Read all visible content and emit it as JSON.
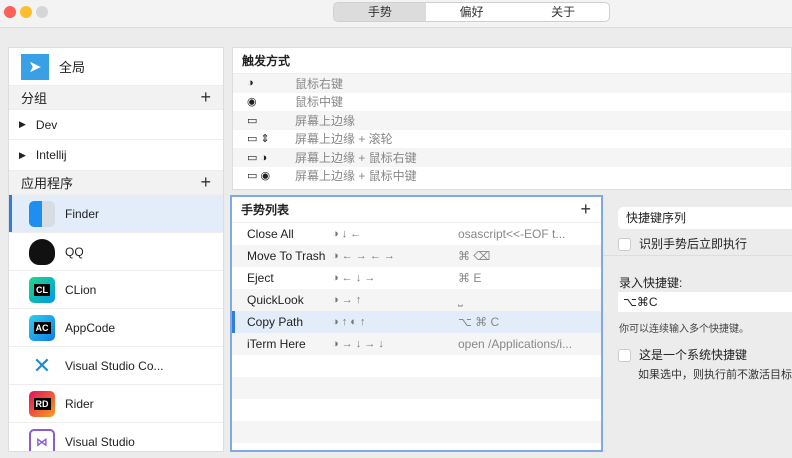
{
  "window": {
    "tabs": [
      {
        "label": "手势",
        "selected": true
      },
      {
        "label": "偏好"
      },
      {
        "label": "关于"
      }
    ]
  },
  "sidebar": {
    "global": "全局",
    "groups_header": "分组",
    "groups": [
      "Dev",
      "Intellij"
    ],
    "apps_header": "应用程序",
    "apps": [
      {
        "label": "Finder",
        "icon": "finder-icon",
        "selected": true
      },
      {
        "label": "QQ",
        "icon": "qq-icon"
      },
      {
        "label": "CLion",
        "icon": "clion-icon"
      },
      {
        "label": "AppCode",
        "icon": "appcode-icon"
      },
      {
        "label": "Visual Studio Co...",
        "icon": "vscode-icon"
      },
      {
        "label": "Rider",
        "icon": "rider-icon"
      },
      {
        "label": "Visual Studio",
        "icon": "visual-studio-icon"
      }
    ]
  },
  "triggers": {
    "title": "触发方式",
    "items": [
      {
        "glyph": "◑",
        "label": "鼠标右键"
      },
      {
        "glyph": "◉",
        "label": "鼠标中键"
      },
      {
        "glyph": "▭",
        "label": "屏幕上边缘"
      },
      {
        "glyph": "▭ ⇕",
        "label": "屏幕上边缘 + 滚轮"
      },
      {
        "glyph": "▭ ◑",
        "label": "屏幕上边缘 + 鼠标右键"
      },
      {
        "glyph": "▭ ◉",
        "label": "屏幕上边缘 + 鼠标中键"
      }
    ]
  },
  "gestures": {
    "title": "手势列表",
    "items": [
      {
        "name": "Close All",
        "gesture": "◑ ↓ ←",
        "action": "osascript<<-EOF  t..."
      },
      {
        "name": "Move To Trash",
        "gesture": "◑ ← → ← →",
        "action": "⌘ ⌫"
      },
      {
        "name": "Eject",
        "gesture": "◑ ← ↓ →",
        "action": "⌘ E"
      },
      {
        "name": "QuickLook",
        "gesture": "◑ → ↑",
        "action": "⎵"
      },
      {
        "name": "Copy Path",
        "gesture": "◑ ↑ ◐ ↑",
        "action": "⌥ ⌘ C",
        "selected": true
      },
      {
        "name": "iTerm Here",
        "gesture": "◑ → ↓ → ↓",
        "action": "open /Applications/i..."
      }
    ]
  },
  "detail": {
    "action_type": "快捷键序列",
    "execute_immediately": "识别手势后立即执行",
    "record_label": "录入快捷键:",
    "shortcut_value": "⌥⌘C",
    "hint": "你可以连续输入多个快捷键。",
    "system_shortcut": "这是一个系统快捷键",
    "system_hint": "如果选中，则执行前不激活目标应用"
  },
  "colors": {
    "accent": "#2f7de1",
    "selected_row": "#e3edfa"
  }
}
